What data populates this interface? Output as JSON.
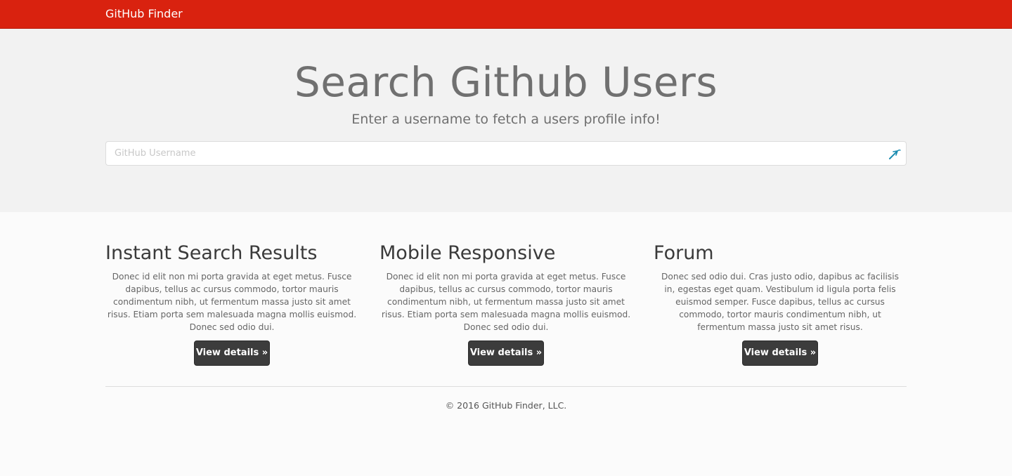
{
  "navbar": {
    "brand": "GitHub Finder",
    "color": "#d9220f"
  },
  "hero": {
    "title": "Search Github Users",
    "subtitle": "Enter a username to fetch a users profile info!",
    "search": {
      "placeholder": "GitHub Username",
      "value": "",
      "icon": "autofill-icon"
    }
  },
  "features": [
    {
      "title": "Instant Search Results",
      "text": "Donec id elit non mi porta gravida at eget metus. Fusce dapibus, tellus ac cursus commodo, tortor mauris condimentum nibh, ut fermentum massa justo sit amet risus. Etiam porta sem malesuada magna mollis euismod. Donec sed odio dui.",
      "button": "View details »"
    },
    {
      "title": "Mobile Responsive",
      "text": "Donec id elit non mi porta gravida at eget metus. Fusce dapibus, tellus ac cursus commodo, tortor mauris condimentum nibh, ut fermentum massa justo sit amet risus. Etiam porta sem malesuada magna mollis euismod. Donec sed odio dui.",
      "button": "View details »"
    },
    {
      "title": "Forum",
      "text": "Donec sed odio dui. Cras justo odio, dapibus ac facilisis in, egestas eget quam. Vestibulum id ligula porta felis euismod semper. Fusce dapibus, tellus ac cursus commodo, tortor mauris condimentum nibh, ut fermentum massa justo sit amet risus.",
      "button": "View details »"
    }
  ],
  "footer": {
    "text": "© 2016 GitHub Finder, LLC."
  }
}
